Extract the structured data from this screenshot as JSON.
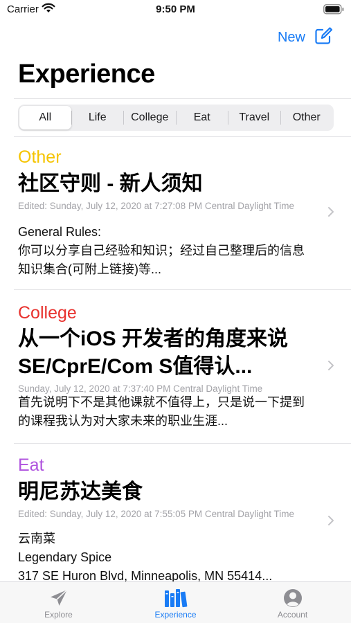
{
  "status": {
    "carrier": "Carrier",
    "time": "9:50 PM"
  },
  "header": {
    "new_label": "New",
    "title": "Experience"
  },
  "segments": [
    {
      "label": "All",
      "selected": true
    },
    {
      "label": "Life",
      "selected": false
    },
    {
      "label": "College",
      "selected": false
    },
    {
      "label": "Eat",
      "selected": false
    },
    {
      "label": "Travel",
      "selected": false
    },
    {
      "label": "Other",
      "selected": false
    }
  ],
  "posts": [
    {
      "category": "Other",
      "category_color": "#f5c400",
      "title": "社区守则 - 新人须知",
      "date": "Edited: Sunday, July 12, 2020 at 7:27:08 PM Central Daylight Time",
      "body": "General Rules:\n你可以分享自己经验和知识；经过自己整理后的信息知识集合(可附上链接)等..."
    },
    {
      "category": "College",
      "category_color": "#e8322e",
      "title": "从一个iOS 开发者的角度来说 SE/CprE/Com S值得认...",
      "date": "Sunday, July 12, 2020 at 7:37:40 PM Central Daylight Time",
      "body": "首先说明下不是其他课就不值得上，只是说一下提到的课程我认为对大家未来的职业生涯..."
    },
    {
      "category": "Eat",
      "category_color": "#af52de",
      "title": "明尼苏达美食",
      "date": "Edited: Sunday, July 12, 2020 at 7:55:05 PM Central Daylight Time",
      "body": "云南菜\nLegendary Spice\n317 SE Huron Blvd, Minneapolis, MN 55414..."
    }
  ],
  "tabs": [
    {
      "label": "Explore",
      "icon": "paperplane-icon",
      "active": false
    },
    {
      "label": "Experience",
      "icon": "books-icon",
      "active": true
    },
    {
      "label": "Account",
      "icon": "person-circle-icon",
      "active": false
    }
  ],
  "colors": {
    "accent": "#1a7cf5",
    "inactive": "#8e8e93"
  }
}
